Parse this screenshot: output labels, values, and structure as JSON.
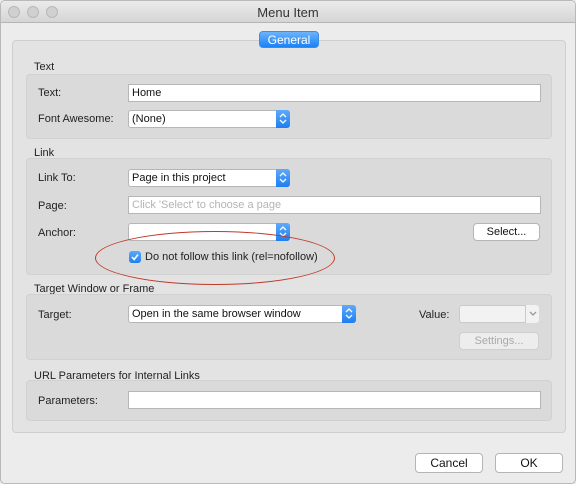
{
  "window": {
    "title": "Menu Item"
  },
  "tabs": [
    {
      "label": "General",
      "selected": true
    }
  ],
  "text_section": {
    "title": "Text",
    "text_label": "Text:",
    "text_value": "Home",
    "font_awesome_label": "Font Awesome:",
    "font_awesome_value": "(None)"
  },
  "link_section": {
    "title": "Link",
    "link_to_label": "Link To:",
    "link_to_value": "Page in this project",
    "page_label": "Page:",
    "page_placeholder": "Click 'Select' to choose a page",
    "anchor_label": "Anchor:",
    "anchor_value": "",
    "select_button": "Select...",
    "nofollow_label": "Do not follow this link (rel=nofollow)",
    "nofollow_checked": true
  },
  "target_section": {
    "title": "Target Window or Frame",
    "target_label": "Target:",
    "target_value": "Open in the same browser window",
    "value_label": "Value:",
    "value_value": "",
    "settings_button": "Settings..."
  },
  "url_section": {
    "title": "URL Parameters for Internal Links",
    "parameters_label": "Parameters:",
    "parameters_value": ""
  },
  "footer": {
    "cancel_label": "Cancel",
    "ok_label": "OK"
  },
  "colors": {
    "accent": "#1a82f7",
    "annotation": "#c0392b"
  },
  "icons": [
    "close-icon",
    "minimize-icon",
    "zoom-icon",
    "chevron-updown-icon",
    "chevron-down-icon",
    "checkmark-icon"
  ]
}
